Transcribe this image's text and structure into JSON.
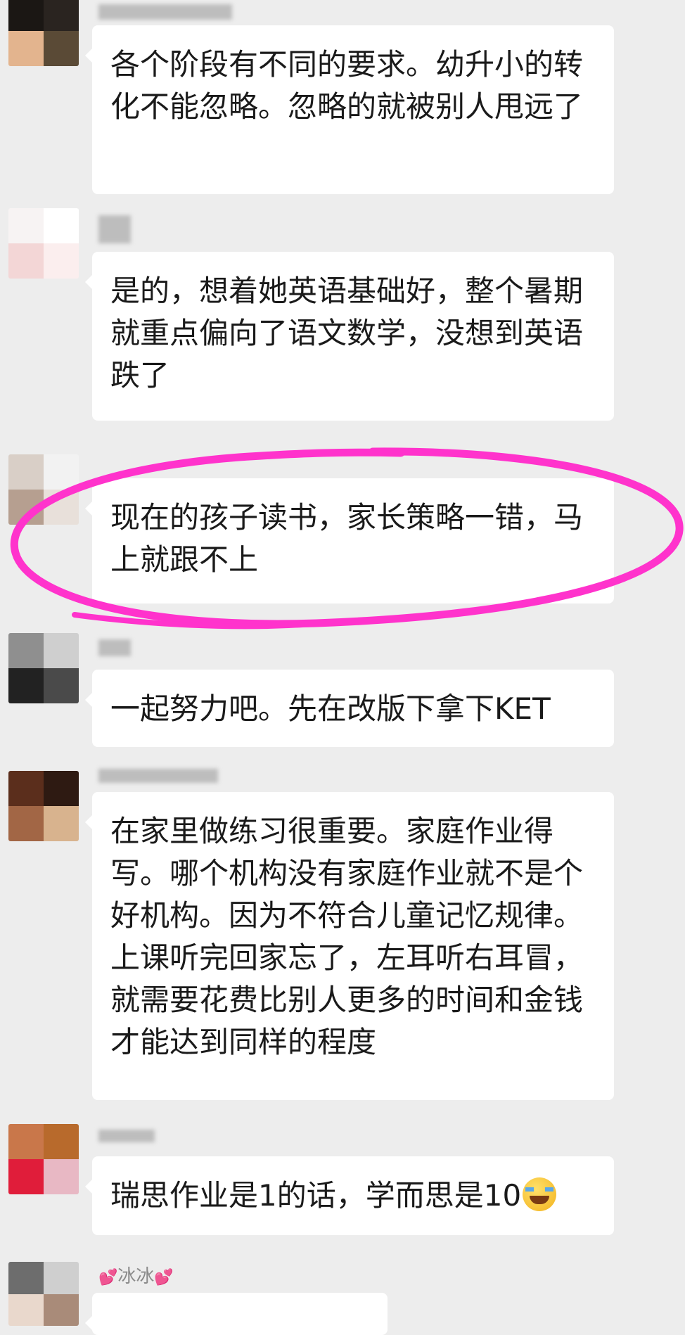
{
  "messages": [
    {
      "sender": "",
      "text": "各个阶段有不同的要求。幼升小的转化不能忽略。忽略的就被别人甩远了"
    },
    {
      "sender": "",
      "text": "是的，想着她英语基础好，整个暑期就重点偏向了语文数学，没想到英语跌了"
    },
    {
      "sender": "",
      "text": "现在的孩子读书，家长策略一错，马上就跟不上"
    },
    {
      "sender": "",
      "text": "一起努力吧。先在改版下拿下KET"
    },
    {
      "sender": "",
      "text": "在家里做练习很重要。家庭作业得写。哪个机构没有家庭作业就不是个好机构。因为不符合儿童记忆规律。上课听完回家忘了，左耳听右耳冒，就需要花费比别人更多的时间和金钱才能达到同样的程度"
    },
    {
      "sender": "",
      "text": "瑞思作业是1的话，学而思是10",
      "emoji": "face-with-tears-of-joy"
    },
    {
      "sender": "冰冰",
      "sender_decoration": "pink-hearts",
      "text": ""
    }
  ],
  "colors": {
    "background": "#ededed",
    "bubble": "#ffffff",
    "highlight_circle": "#ff33cc"
  },
  "icons": {
    "sender_decoration": "💕"
  }
}
